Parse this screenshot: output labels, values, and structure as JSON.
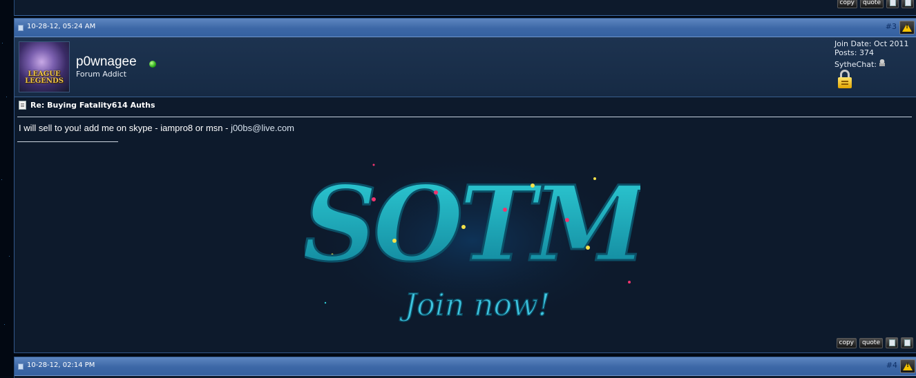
{
  "previous_post": {
    "buttons": {
      "copy": "copy",
      "quote": "quote"
    }
  },
  "post": {
    "date": "10-28-12, 05:24 AM",
    "number": "#3",
    "user": {
      "name": "p0wnagee",
      "title": "Forum Addict",
      "join_date": "Join Date: Oct 2011",
      "posts": "Posts: 374",
      "chat_label": "SytheChat:",
      "avatar_text_line1": "LEAGUE",
      "avatar_text_line2": "LEGENDS"
    },
    "title": "Re: Buying Fatality614 Auths",
    "message_prefix": "I will sell to you! add me on skype - iampro8 or msn - ",
    "message_email": "j00bs@live.com",
    "signature": {
      "big_text": "SOTM",
      "sub_text": "Join now!",
      "colors": {
        "primary": "#1fb8c7",
        "secondary": "#18a6b4",
        "dots": "#f0346e",
        "accent": "#f5e14a"
      }
    },
    "buttons": {
      "copy": "copy",
      "quote": "quote"
    }
  },
  "next_post": {
    "date": "10-28-12, 02:14 PM",
    "number": "#4"
  },
  "colors": {
    "header_blue": "#3c67a6",
    "post_bg": "#0d1a2c",
    "userbar_bg": "#1d3350",
    "online_green": "#2caa1a"
  }
}
